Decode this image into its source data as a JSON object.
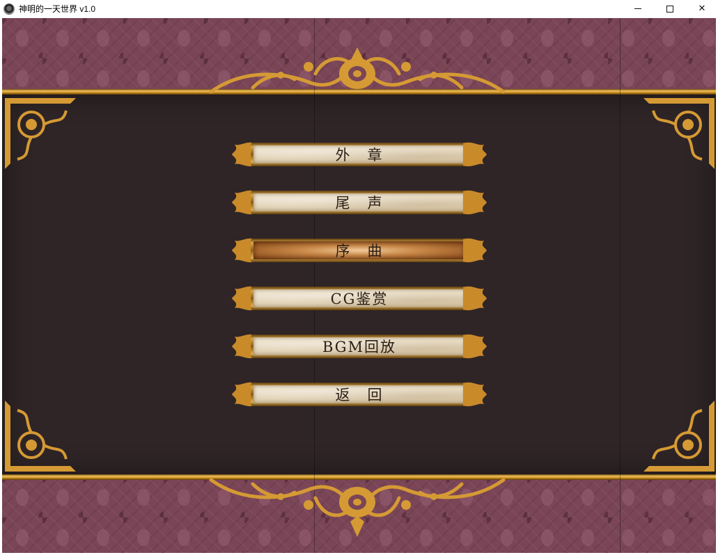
{
  "window": {
    "title": "神明的一天世界 v1.0",
    "minimize_glyph": "",
    "maximize_glyph": "",
    "close_glyph": "✕"
  },
  "menu": {
    "selected_index": 2,
    "items": [
      {
        "label": "外　章"
      },
      {
        "label": "尾　声"
      },
      {
        "label": "序　曲"
      },
      {
        "label": "CG鉴赏"
      },
      {
        "label": "BGM回放"
      },
      {
        "label": "返　回"
      }
    ]
  },
  "colors": {
    "panel": "#2f2527",
    "damask": "#7a4556",
    "gold": "#d9a447",
    "selected_plate": "#c98848"
  }
}
